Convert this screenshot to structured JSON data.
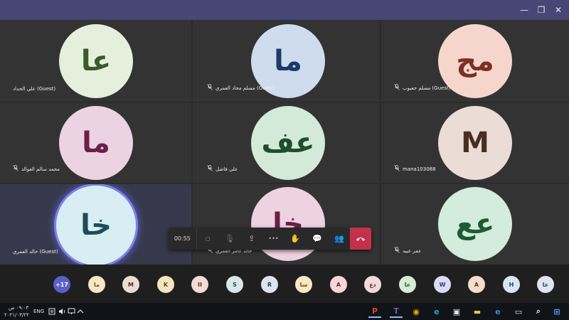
{
  "window": {
    "controls": [
      {
        "name": "minimize-button",
        "symbol": "—"
      },
      {
        "name": "maximize-button",
        "symbol": "❐"
      },
      {
        "name": "close-button",
        "symbol": "✕"
      }
    ]
  },
  "tiles": [
    {
      "name": "tile-ali-alhaddad",
      "initials": "عا",
      "label": "علي الحداد (Guest)",
      "bg": "#e6efdc",
      "fg": "#3b5b2a",
      "mic_off": false,
      "speaking": false
    },
    {
      "name": "tile-muslim-alamri",
      "initials": "ما",
      "label": "مسلم محاد العمري (Guest)",
      "bg": "#cfdcee",
      "fg": "#1c3b6b",
      "mic_off": true,
      "speaking": false
    },
    {
      "name": "tile-muslim-jaaboob",
      "initials": "مج",
      "label": "مسلم جعبوب (Guest)",
      "bg": "#f6d6cc",
      "fg": "#7d3121",
      "mic_off": true,
      "speaking": false
    },
    {
      "name": "tile-mohammed-alawaled",
      "initials": "ما",
      "label": "محمد سالم العوالد",
      "bg": "#ecd3e2",
      "fg": "#6b1f4a",
      "mic_off": true,
      "speaking": false
    },
    {
      "name": "tile-ali-fadhel",
      "initials": "عف",
      "label": "علي فاضل",
      "bg": "#d4ead9",
      "fg": "#1e4f2c",
      "mic_off": true,
      "speaking": false
    },
    {
      "name": "tile-mana103088",
      "initials": "M",
      "label": "mana103088",
      "bg": "#ebdcd6",
      "fg": "#4a2e22",
      "mic_off": true,
      "speaking": false
    },
    {
      "name": "tile-khaled-alamri",
      "initials": "خا",
      "label": "خالد العمري (Guest)",
      "bg": "#d8eef3",
      "fg": "#1c4d5a",
      "mic_off": false,
      "speaking": true
    },
    {
      "name": "tile-khaled-amer",
      "initials": "خا",
      "label": "خالد عامر العمري",
      "bg": "#eed2e0",
      "fg": "#6b2045",
      "mic_off": true,
      "speaking": false
    },
    {
      "name": "tile-omar-obaid",
      "initials": "عع",
      "label": "عمر عبيد",
      "bg": "#d3ecdc",
      "fg": "#1f5a35",
      "mic_off": true,
      "speaking": false
    }
  ],
  "controls": {
    "timer": "00:55",
    "buttons": [
      {
        "name": "camera-off-button",
        "icon": "camera-off-icon",
        "glyph": "▫",
        "dim": true
      },
      {
        "name": "mic-off-button",
        "icon": "mic-off-icon",
        "glyph": "🎙",
        "dim": true
      },
      {
        "name": "share-screen-button",
        "icon": "share-screen-icon",
        "glyph": "⇪",
        "dim": false
      },
      {
        "name": "more-actions-button",
        "icon": "more-icon",
        "glyph": "•••",
        "dim": false
      },
      {
        "name": "raise-hand-button",
        "icon": "hand-icon",
        "glyph": "✋",
        "dim": false
      },
      {
        "name": "chat-button",
        "icon": "chat-icon",
        "glyph": "💬",
        "dim": false
      },
      {
        "name": "participants-button",
        "icon": "participants-icon",
        "glyph": "👥",
        "dim": false
      }
    ],
    "hangup_icon": "hang-up-icon"
  },
  "overflow": [
    {
      "label": "+17",
      "bg": "#5b5fc7",
      "fg": "#ffffff"
    },
    {
      "label": "ما",
      "bg": "#f7e7c6",
      "fg": "#6b4a12"
    },
    {
      "label": "M",
      "bg": "#ecdcd4",
      "fg": "#4a2e22"
    },
    {
      "label": "K",
      "bg": "#f3e5c0",
      "fg": "#5a4614"
    },
    {
      "label": "II",
      "bg": "#f2dcd6",
      "fg": "#5a2a20"
    },
    {
      "label": "S",
      "bg": "#d9e7e8",
      "fg": "#24494c"
    },
    {
      "label": "R",
      "bg": "#dde3ec",
      "fg": "#2a3a57"
    },
    {
      "label": "سا",
      "bg": "#f7e7c6",
      "fg": "#6b4a12"
    },
    {
      "label": "A",
      "bg": "#f6d6d6",
      "fg": "#7a2626"
    },
    {
      "label": "دع",
      "bg": "#f1d9dc",
      "fg": "#6b2a33"
    },
    {
      "label": "عا",
      "bg": "#d6ecd8",
      "fg": "#24532c"
    },
    {
      "label": "W",
      "bg": "#dcdcf3",
      "fg": "#34348a"
    },
    {
      "label": "A",
      "bg": "#f4dccf",
      "fg": "#6b3420"
    },
    {
      "label": "H",
      "bg": "#d8e6f2",
      "fg": "#24446b"
    },
    {
      "label": "عا",
      "bg": "#dfe4ef",
      "fg": "#2f3c5a"
    }
  ],
  "taskbar": {
    "time": "٠٩:٠٣ ص",
    "date": "٢٠٢١/٠٣/٢٢",
    "language": "ENG",
    "apps": [
      {
        "name": "powerpoint-app",
        "icon": "powerpoint-icon",
        "glyph": "P",
        "color": "#d24726"
      },
      {
        "name": "teams-app",
        "icon": "teams-icon",
        "glyph": "T",
        "color": "#6264a7"
      },
      {
        "name": "chrome-app",
        "icon": "chrome-icon",
        "glyph": "◉",
        "color": "#e8b400"
      },
      {
        "name": "ie-app",
        "icon": "internet-explorer-icon",
        "glyph": "e",
        "color": "#1ea7e4"
      },
      {
        "name": "store-app",
        "icon": "store-icon",
        "glyph": "▣",
        "color": "#e6e6e6"
      },
      {
        "name": "explorer-app",
        "icon": "folder-icon",
        "glyph": "▬",
        "color": "#f2c14e"
      },
      {
        "name": "edge-app",
        "icon": "edge-icon",
        "glyph": "e",
        "color": "#2f8fe0"
      },
      {
        "name": "task-view-app",
        "icon": "task-view-icon",
        "glyph": "▭",
        "color": "#e6e6e6"
      },
      {
        "name": "search-app",
        "icon": "search-icon",
        "glyph": "⌕",
        "color": "#e6e6e6"
      },
      {
        "name": "start-app",
        "icon": "windows-start-icon",
        "glyph": "⊞",
        "color": "#4aa3ff"
      }
    ]
  }
}
